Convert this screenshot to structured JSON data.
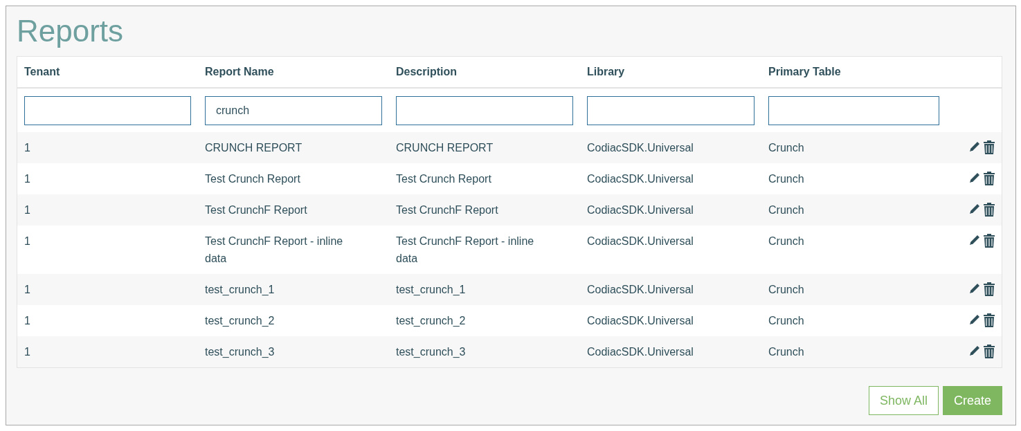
{
  "title": "Reports",
  "table": {
    "columns": [
      {
        "label": "Tenant"
      },
      {
        "label": "Report Name",
        "filter": "crunch"
      },
      {
        "label": "Description"
      },
      {
        "label": "Library"
      },
      {
        "label": "Primary Table"
      }
    ],
    "rows": [
      {
        "cells": [
          "1",
          "CRUNCH REPORT",
          "CRUNCH REPORT",
          "CodiacSDK.Universal",
          "Crunch"
        ]
      },
      {
        "cells": [
          "1",
          "Test Crunch Report",
          "Test Crunch Report",
          "CodiacSDK.Universal",
          "Crunch"
        ]
      },
      {
        "cells": [
          "1",
          "Test CrunchF Report",
          "Test CrunchF Report",
          "CodiacSDK.Universal",
          "Crunch"
        ]
      },
      {
        "cells": [
          "1",
          "Test CrunchF Report - inline data",
          "Test CrunchF Report - inline data",
          "CodiacSDK.Universal",
          "Crunch"
        ]
      },
      {
        "cells": [
          "1",
          "test_crunch_1",
          "test_crunch_1",
          "CodiacSDK.Universal",
          "Crunch"
        ]
      },
      {
        "cells": [
          "1",
          "test_crunch_2",
          "test_crunch_2",
          "CodiacSDK.Universal",
          "Crunch"
        ]
      },
      {
        "cells": [
          "1",
          "test_crunch_3",
          "test_crunch_3",
          "CodiacSDK.Universal",
          "Crunch"
        ]
      }
    ]
  },
  "buttons": [
    {
      "label": "Show All",
      "kind": "outline"
    },
    {
      "label": "Create",
      "kind": "primary"
    }
  ]
}
